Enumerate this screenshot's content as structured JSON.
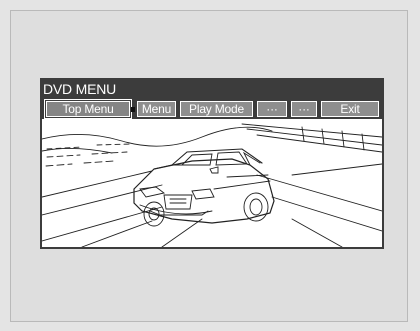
{
  "window": {
    "title": "DVD MENU"
  },
  "menu": {
    "top_menu": "Top Menu",
    "menu": "Menu",
    "play_mode": "Play Mode",
    "more1": "···",
    "more2": "···",
    "exit": "Exit",
    "selected": "Top Menu"
  },
  "colors": {
    "bar": "#3c3c3c",
    "button": "#8e8e8e",
    "button_text": "#ffffff",
    "background": "#e4e4e4"
  }
}
